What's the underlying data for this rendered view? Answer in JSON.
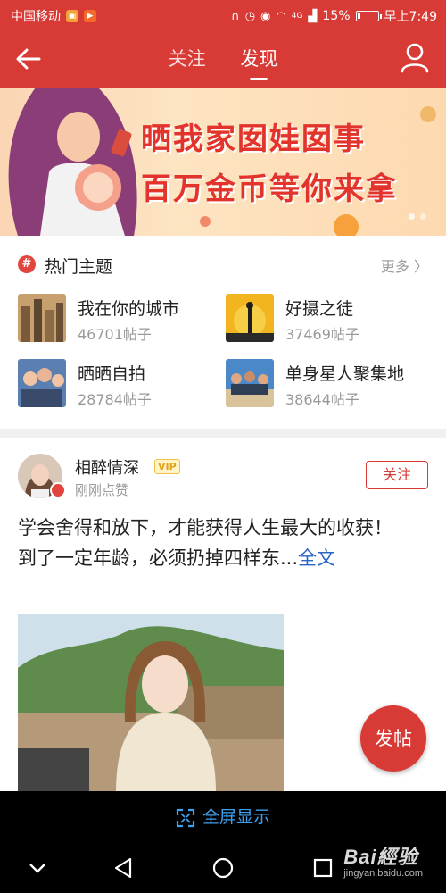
{
  "status_bar": {
    "carrier": "中国移动",
    "signal": "4G",
    "battery": "15%",
    "time": "早上7:49"
  },
  "top_nav": {
    "tabs": [
      {
        "label": "关注",
        "active": false
      },
      {
        "label": "发现",
        "active": true
      }
    ]
  },
  "banner": {
    "line1": "晒我家囡娃囡事",
    "line2": "百万金币等你来拿"
  },
  "hot_topics": {
    "title": "热门主题",
    "icon": "#",
    "more": "更多 〉",
    "items": [
      {
        "name": "我在你的城市",
        "count": "46701帖子"
      },
      {
        "name": "好摄之徒",
        "count": "37469帖子"
      },
      {
        "name": "晒晒自拍",
        "count": "28784帖子"
      },
      {
        "name": "单身星人聚集地",
        "count": "38644帖子"
      }
    ]
  },
  "post": {
    "username": "相醉情深",
    "vip": "VIP",
    "status": "刚刚点赞",
    "follow": "关注",
    "line1": "学会舍得和放下，才能获得人生最大的收获！",
    "line2": "到了一定年龄，必须扔掉四样东...",
    "more": "全文"
  },
  "fab": {
    "label": "发帖"
  },
  "fullscreen": {
    "label": "全屏显示"
  },
  "watermark": {
    "main": "Bai經验",
    "sub": "jingyan.baidu.com"
  },
  "colors": {
    "brand_red": "#d83a35",
    "link_blue": "#2a66c4",
    "fullscreen_blue": "#3fa0ee"
  }
}
